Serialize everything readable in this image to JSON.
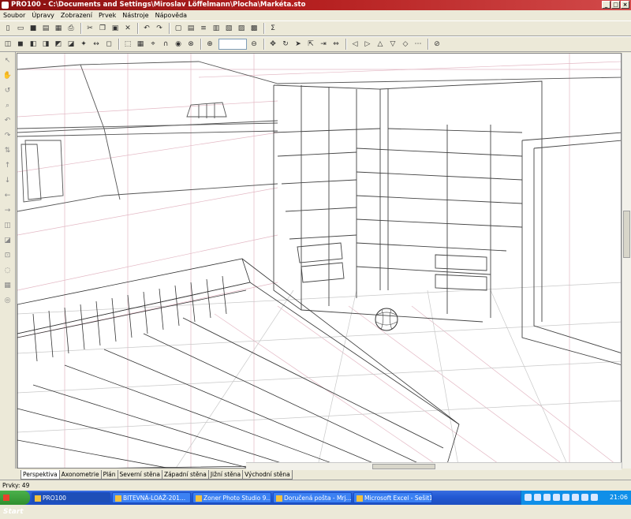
{
  "window": {
    "title": "PRO100 - C:\\Documents and Settings\\Miroslav Löffelmann\\Plocha\\Markéta.sto"
  },
  "menu": [
    "Soubor",
    "Úpravy",
    "Zobrazení",
    "Prvek",
    "Nástroje",
    "Nápověda"
  ],
  "view_tabs": [
    "Perspektiva",
    "Axonometrie",
    "Plán",
    "Severní stěna",
    "Západní stěna",
    "Jižní stěna",
    "Východní stěna"
  ],
  "status": {
    "items_label": "Prvky: 49"
  },
  "taskbar": {
    "start_label": "Start",
    "items": [
      "PRO100",
      "BITEVNÁ-LOAŽ-201...",
      "Zoner Photo Studio 9...",
      "Doručená pošta - Mrj...",
      "Microsoft Excel - Sešit1"
    ],
    "clock": "21:06"
  }
}
